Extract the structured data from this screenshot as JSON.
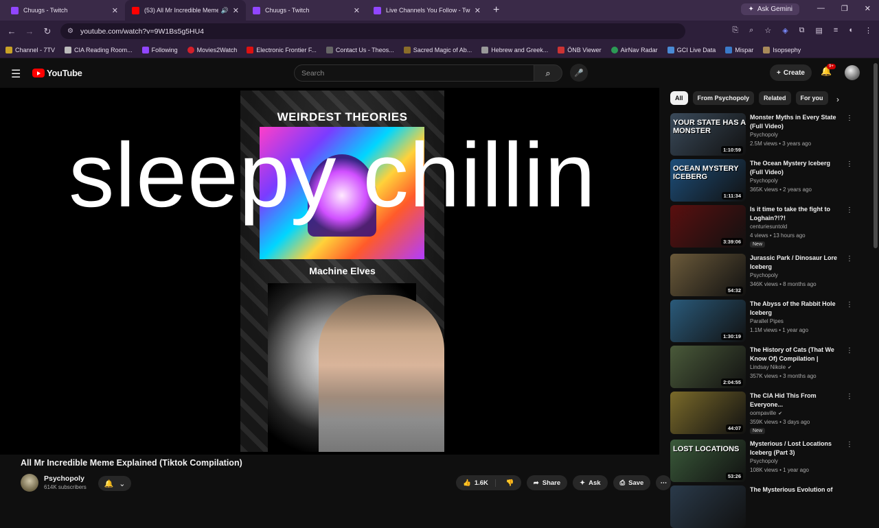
{
  "browser": {
    "tabs": [
      {
        "title": "Chuugs - Twitch",
        "color": "#9146ff",
        "active": false
      },
      {
        "title": "(53) All Mr Incredible Meme",
        "color": "#ff0000",
        "active": true
      },
      {
        "title": "Chuugs - Twitch",
        "color": "#9146ff",
        "active": false
      },
      {
        "title": "Live Channels You Follow - Twit",
        "color": "#9146ff",
        "active": false
      }
    ],
    "gemini_label": "Ask Gemini",
    "url": "youtube.com/watch?v=9W1Bs5g5HU4",
    "bookmarks": [
      "Channel - 7TV",
      "CIA Reading Room...",
      "Following",
      "Movies2Watch",
      "Electronic Frontier F...",
      "Contact Us - Theos...",
      "Sacred Magic of Ab...",
      "Hebrew and Greek...",
      "ÖNB Viewer",
      "AirNav Radar",
      "GCI Live Data",
      "Mispar",
      "Isopsephy"
    ]
  },
  "youtube": {
    "logo_text": "YouTube",
    "search_placeholder": "Search",
    "create_label": "Create",
    "notif_badge": "9+"
  },
  "video": {
    "overlay_text": "sleepy chillin",
    "frame_title": "WEIRDEST THEORIES",
    "frame_caption": "Machine Elves",
    "title": "All Mr Incredible Meme Explained (Tiktok Compilation)",
    "channel": "Psychopoly",
    "subscribers": "614K subscribers",
    "likes": "1.6K",
    "share_label": "Share",
    "ask_label": "Ask",
    "save_label": "Save"
  },
  "sidebar": {
    "chips": [
      "All",
      "From Psychopoly",
      "Related",
      "For you"
    ],
    "recommendations": [
      {
        "title": "Monster Myths in Every State (Full Video)",
        "channel": "Psychopoly",
        "meta": "2.5M views • 3 years ago",
        "duration": "1:10:59",
        "thumb_caption": "YOUR STATE HAS A MONSTER",
        "thumb_color": "#3a4a5a",
        "is_new": false,
        "verified": false
      },
      {
        "title": "The Ocean Mystery Iceberg (Full Video)",
        "channel": "Psychopoly",
        "meta": "365K views • 2 years ago",
        "duration": "1:11:34",
        "thumb_caption": "OCEAN MYSTERY ICEBERG",
        "thumb_color": "#1d4e7a",
        "is_new": false,
        "verified": false
      },
      {
        "title": "Is it time to take the fight to Loghain?!?!",
        "channel": "centuriesuntold",
        "meta": "4 views • 13 hours ago",
        "duration": "3:39:06",
        "thumb_caption": "",
        "thumb_color": "#5a0f0f",
        "is_new": true,
        "verified": false
      },
      {
        "title": "Jurassic Park / Dinosaur Lore Iceberg",
        "channel": "Psychopoly",
        "meta": "346K views • 8 months ago",
        "duration": "54:32",
        "thumb_caption": "",
        "thumb_color": "#6b5a3a",
        "is_new": false,
        "verified": false
      },
      {
        "title": "The Abyss of the Rabbit Hole Iceberg",
        "channel": "Parallel Pipes",
        "meta": "1.1M views • 1 year ago",
        "duration": "1:30:19",
        "thumb_caption": "",
        "thumb_color": "#2a5a7a",
        "is_new": false,
        "verified": false
      },
      {
        "title": "The History of Cats (That We Know Of) Compilation | Lindsa...",
        "channel": "Lindsay Nikole",
        "meta": "357K views • 3 months ago",
        "duration": "2:04:55",
        "thumb_caption": "",
        "thumb_color": "#4a5a3a",
        "is_new": false,
        "verified": true
      },
      {
        "title": "The CIA Hid This From Everyone...",
        "channel": "oompaville",
        "meta": "359K views • 3 days ago",
        "duration": "44:07",
        "thumb_caption": "",
        "thumb_color": "#7a6a2a",
        "is_new": true,
        "verified": true
      },
      {
        "title": "Mysterious / Lost Locations Iceberg (Part 3)",
        "channel": "Psychopoly",
        "meta": "108K views • 1 year ago",
        "duration": "53:26",
        "thumb_caption": "LOST LOCATIONS",
        "thumb_color": "#3a5a3a",
        "is_new": false,
        "verified": false
      },
      {
        "title": "The Mysterious Evolution of",
        "channel": "",
        "meta": "",
        "duration": "",
        "thumb_caption": "",
        "thumb_color": "#2a3a4a",
        "is_new": false,
        "verified": false
      }
    ]
  }
}
